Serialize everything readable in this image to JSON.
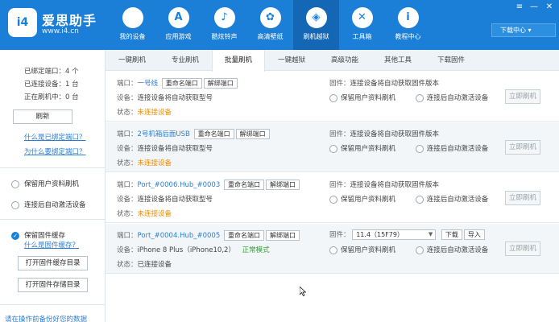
{
  "app": {
    "brand": "爱思助手",
    "url": "www.i4.cn",
    "logo_text": "i4"
  },
  "nav": [
    {
      "label": "我的设备",
      "icon": "apple-icon",
      "glyph": ""
    },
    {
      "label": "应用游戏",
      "icon": "app-store-icon",
      "glyph": "A"
    },
    {
      "label": "酷炫铃声",
      "icon": "bell-icon",
      "glyph": "♪"
    },
    {
      "label": "高清壁纸",
      "icon": "flower-icon",
      "glyph": "✿"
    },
    {
      "label": "刷机越狱",
      "icon": "box-icon",
      "glyph": "◈",
      "active": true
    },
    {
      "label": "工具箱",
      "icon": "tools-icon",
      "glyph": "✕"
    },
    {
      "label": "教程中心",
      "icon": "info-icon",
      "glyph": "i"
    }
  ],
  "window": {
    "download_center": "下载中心 ▾",
    "menu": "≡",
    "minimize": "—",
    "close": "✕"
  },
  "left": {
    "bound_ports": "已绑定端口：4 个",
    "connected": "已连接设备：1 台",
    "flashing": "正在刷机中：0 台",
    "refresh": "刷新",
    "link_bound": "什么是已绑定端口？",
    "link_why": "为什么要绑定端口？",
    "opt_keep": "保留用户资料刷机",
    "opt_activate": "连接后自动激活设备",
    "opt_cache": "保留固件缓存",
    "link_cache": "什么是固件缓存？",
    "open_cache": "打开固件缓存目录",
    "open_store": "打开固件存储目录",
    "bottom_hint": "请在操作前备份好您的数据"
  },
  "tabs": [
    "一键刷机",
    "专业刷机",
    "批量刷机",
    "一键越狱",
    "高级功能",
    "其他工具",
    "下载固件"
  ],
  "labels": {
    "port": "端口：",
    "device": "设备：",
    "status": "状态：",
    "firmware": "固件：",
    "rename": "重命名端口",
    "unbind": "解绑端口",
    "keep_data": "保留用户资料刷机",
    "auto_activate": "连接后自动激活设备",
    "flash_now": "立即刷机",
    "download": "下载",
    "import": "导入"
  },
  "ports": [
    {
      "name": "一号线",
      "device": "连接设备将自动获取型号",
      "status": "未连接设备",
      "firmware": "连接设备将自动获取固件版本"
    },
    {
      "name": "2号机箱后面USB",
      "device": "连接设备将自动获取型号",
      "status": "未连接设备",
      "firmware": "连接设备将自动获取固件版本"
    },
    {
      "name": "Port_#0006.Hub_#0003",
      "device": "连接设备将自动获取型号",
      "status": "未连接设备",
      "firmware": "连接设备将自动获取固件版本"
    },
    {
      "name": "Port_#0004.Hub_#0005",
      "device": "iPhone 8 Plus（iPhone10,2）",
      "mode": "正常模式",
      "status": "已连接设备",
      "firmware_select": "11.4（15F79）"
    }
  ]
}
